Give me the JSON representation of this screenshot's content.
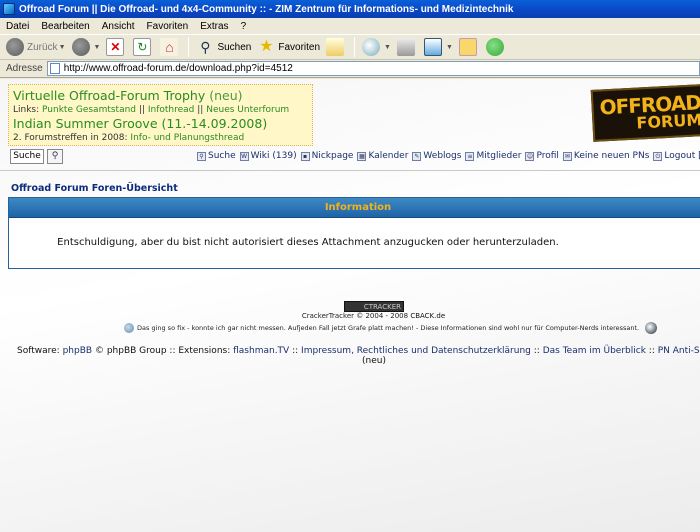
{
  "window": {
    "title": "Offroad Forum || Die Offroad- und 4x4-Community :: - ZIM Zentrum für Informations- und Medizintechnik"
  },
  "menu": [
    "Datei",
    "Bearbeiten",
    "Ansicht",
    "Favoriten",
    "Extras",
    "?"
  ],
  "toolbar": {
    "back": "Zurück",
    "search": "Suchen",
    "favorites": "Favoriten"
  },
  "address": {
    "label": "Adresse",
    "url": "http://www.offroad-forum.de/download.php?id=4512"
  },
  "announce": {
    "line1_title": "Virtuelle Offroad-Forum Trophy",
    "line1_neu": "(neu)",
    "links_prefix": "Links:",
    "link1": "Punkte Gesamtstand",
    "link2": "Infothread",
    "link3": "Neues Unterforum",
    "sep": "||",
    "line2_title": "Indian Summer Groove (11.-14.09.2008)",
    "line3_prefix": "2. Forumstreffen in 2008:",
    "line3_link": "Info- und Planungsthread"
  },
  "logo": {
    "line1": "OFFROAD",
    "line2": "FORUM"
  },
  "search": {
    "button": "Suche"
  },
  "nav": [
    {
      "label": "Suche"
    },
    {
      "label": "Wiki (139)"
    },
    {
      "label": "Nickpage"
    },
    {
      "label": "Kalender"
    },
    {
      "label": "Weblogs"
    },
    {
      "label": "Mitglieder"
    },
    {
      "label": "Profil"
    },
    {
      "label": "Keine neuen PNs"
    },
    {
      "label": "Logout [ M"
    }
  ],
  "breadcrumb": "Offroad Forum Foren-Übersicht",
  "info": {
    "heading": "Information",
    "message": "Entschuldigung, aber du bist nicht autorisiert dieses Attachment anzugucken oder herunterzuladen."
  },
  "footer": {
    "cracker_badge": "CTRACKER",
    "cracker_text": "CrackerTracker © 2004 - 2008",
    "cracker_link": "CBACK.de",
    "stats": "Das ging so fix - konnte ich gar nicht messen. Aufjeden Fall jetzt Grafe platt machen!  - Diese Informationen sind wohl nur für Computer-Nerds interessant.",
    "software_prefix": "Software:",
    "phpbb": "phpBB",
    "phpbb_group": "© phpBB Group :: Extensions:",
    "flashman": "flashman.TV",
    "impressum": "Impressum, Rechtliches und Datenschutzerklärung",
    "team": "Das Team im Überblick",
    "pn_spam": "PN Anti-Spammer",
    "sep": "::",
    "neu": "(neu)"
  }
}
